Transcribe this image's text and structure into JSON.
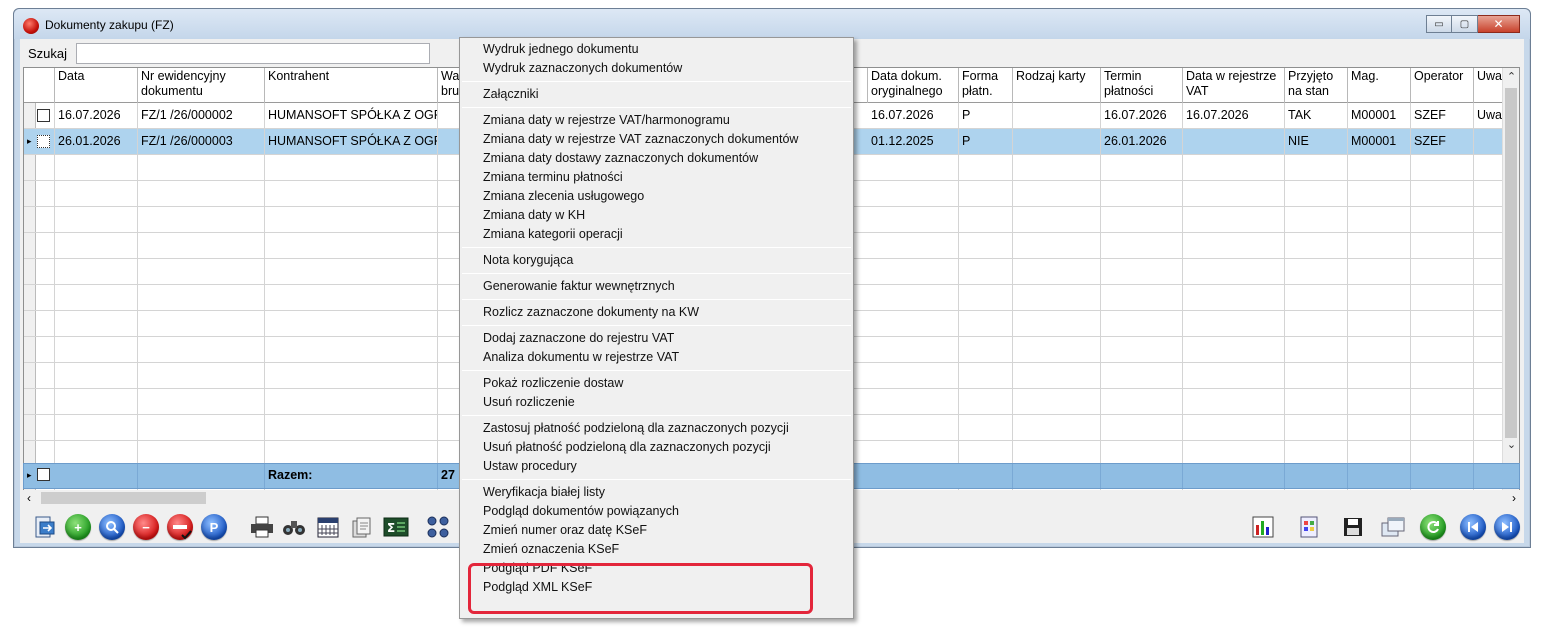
{
  "window": {
    "title": "Dokumenty zakupu (FZ)",
    "minimize": "▭",
    "maximize": "▢",
    "close": "✕"
  },
  "search": {
    "label": "Szukaj",
    "value": ""
  },
  "columns": {
    "data": "Data",
    "nr1": "Nr ewidencyjny",
    "nr2": "dokumentu",
    "kontrahent": "Kontrahent",
    "war1": "War",
    "war2": "brutt",
    "datadok1": "Data dokum.",
    "datadok2": "oryginalnego",
    "forma1": "Forma",
    "forma2": "płatn.",
    "rodzaj": "Rodzaj karty",
    "termin1": "Termin",
    "termin2": "płatności",
    "datavat1": "Data w rejestrze",
    "datavat2": "VAT",
    "przyjeto1": "Przyjęto",
    "przyjeto2": "na stan",
    "mag": "Mag.",
    "operator": "Operator",
    "uwagi": "Uwag"
  },
  "rows": [
    {
      "data": "16.07.2026",
      "nr": "FZ/1  /26/000002",
      "kontrahent": "HUMANSOFT SPÓŁKA Z OGRA",
      "datadok": "16.07.2026",
      "forma": "P",
      "rodzaj": "",
      "termin": "16.07.2026",
      "datavat": "16.07.2026",
      "przyjeto": "TAK",
      "mag": "M00001",
      "operator": "SZEF",
      "uwagi": "Uwag"
    },
    {
      "data": "26.01.2026",
      "nr": "FZ/1  /26/000003",
      "kontrahent": "HUMANSOFT SPÓŁKA Z OGRA",
      "datadok": "01.12.2025",
      "forma": "P",
      "rodzaj": "",
      "termin": "26.01.2026",
      "datavat": "",
      "przyjeto": "NIE",
      "mag": "M00001",
      "operator": "SZEF",
      "uwagi": ""
    }
  ],
  "footer": {
    "label": "Razem:",
    "value": "27"
  },
  "menu": {
    "g1": [
      "Wydruk jednego dokumentu",
      "Wydruk zaznaczonych dokumentów"
    ],
    "g2": [
      "Załączniki"
    ],
    "g3": [
      "Zmiana daty w rejestrze VAT/harmonogramu",
      "Zmiana daty w rejestrze VAT zaznaczonych dokumentów",
      "Zmiana daty dostawy zaznaczonych dokumentów",
      "Zmiana terminu płatności",
      "Zmiana zlecenia usługowego",
      "Zmiana daty w KH",
      "Zmiana kategorii operacji"
    ],
    "g4": [
      "Nota korygująca"
    ],
    "g5": [
      "Generowanie faktur wewnętrznych"
    ],
    "g6": [
      "Rozlicz zaznaczone dokumenty na KW"
    ],
    "g7": [
      "Dodaj zaznaczone do rejestru VAT",
      "Analiza dokumentu w rejestrze VAT"
    ],
    "g8": [
      "Pokaż rozliczenie dostaw",
      "Usuń rozliczenie"
    ],
    "g9": [
      "Zastosuj płatność podzieloną dla zaznaczonych pozycji",
      "Usuń płatność podzieloną dla zaznaczonych pozycji",
      "Ustaw procedury"
    ],
    "g10": [
      "Weryfikacja białej listy",
      "Podgląd dokumentów powiązanych",
      "Zmień numer oraz datę KSeF",
      "Zmień oznaczenia KSeF",
      "Podgląd PDF KSeF",
      "Podgląd XML KSeF"
    ]
  },
  "toolbar": {
    "p_label": "P",
    "plus": "+",
    "minus": "−"
  },
  "colors": {
    "selected_row": "#aed3ee",
    "footer": "#8fbde3",
    "highlight_box": "#e3263b"
  }
}
